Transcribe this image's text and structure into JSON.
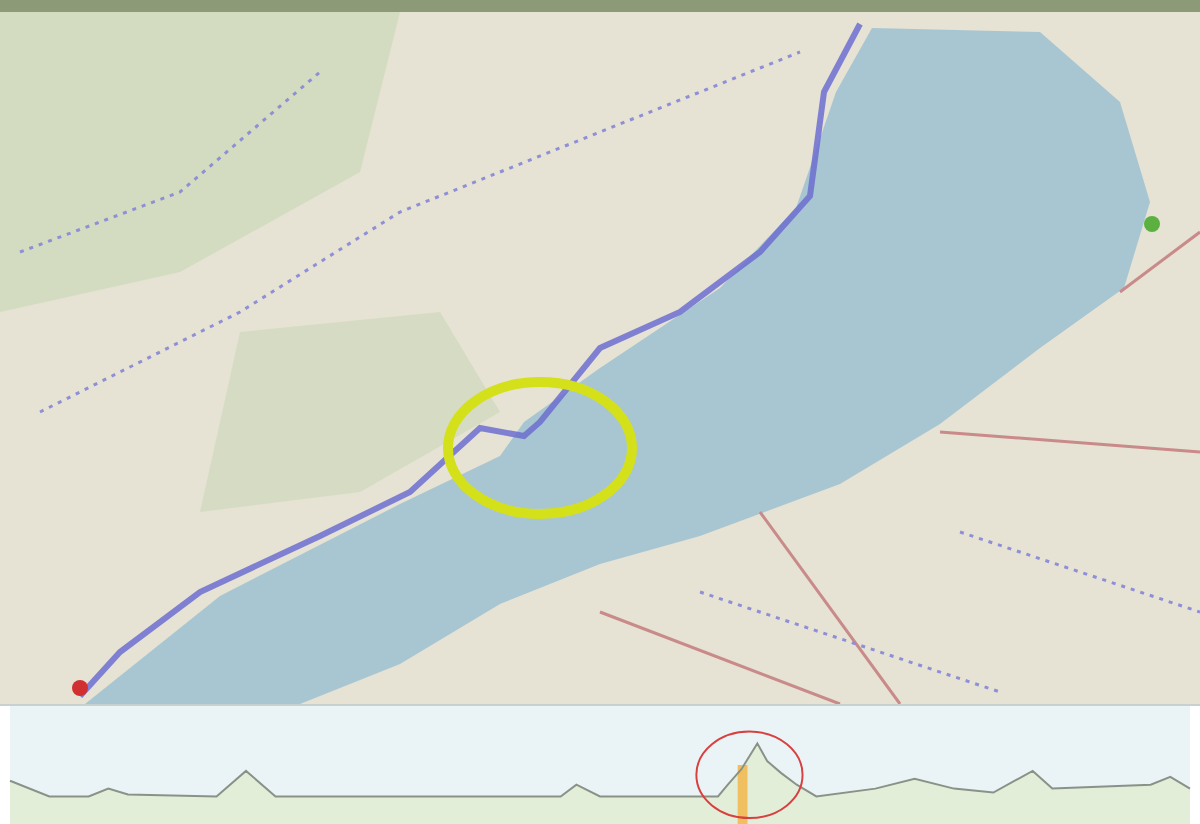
{
  "map": {
    "route_shown": true,
    "marked_area": true
  },
  "elevation_profile": {
    "highlight_segment": true,
    "marked_peak": true
  }
}
